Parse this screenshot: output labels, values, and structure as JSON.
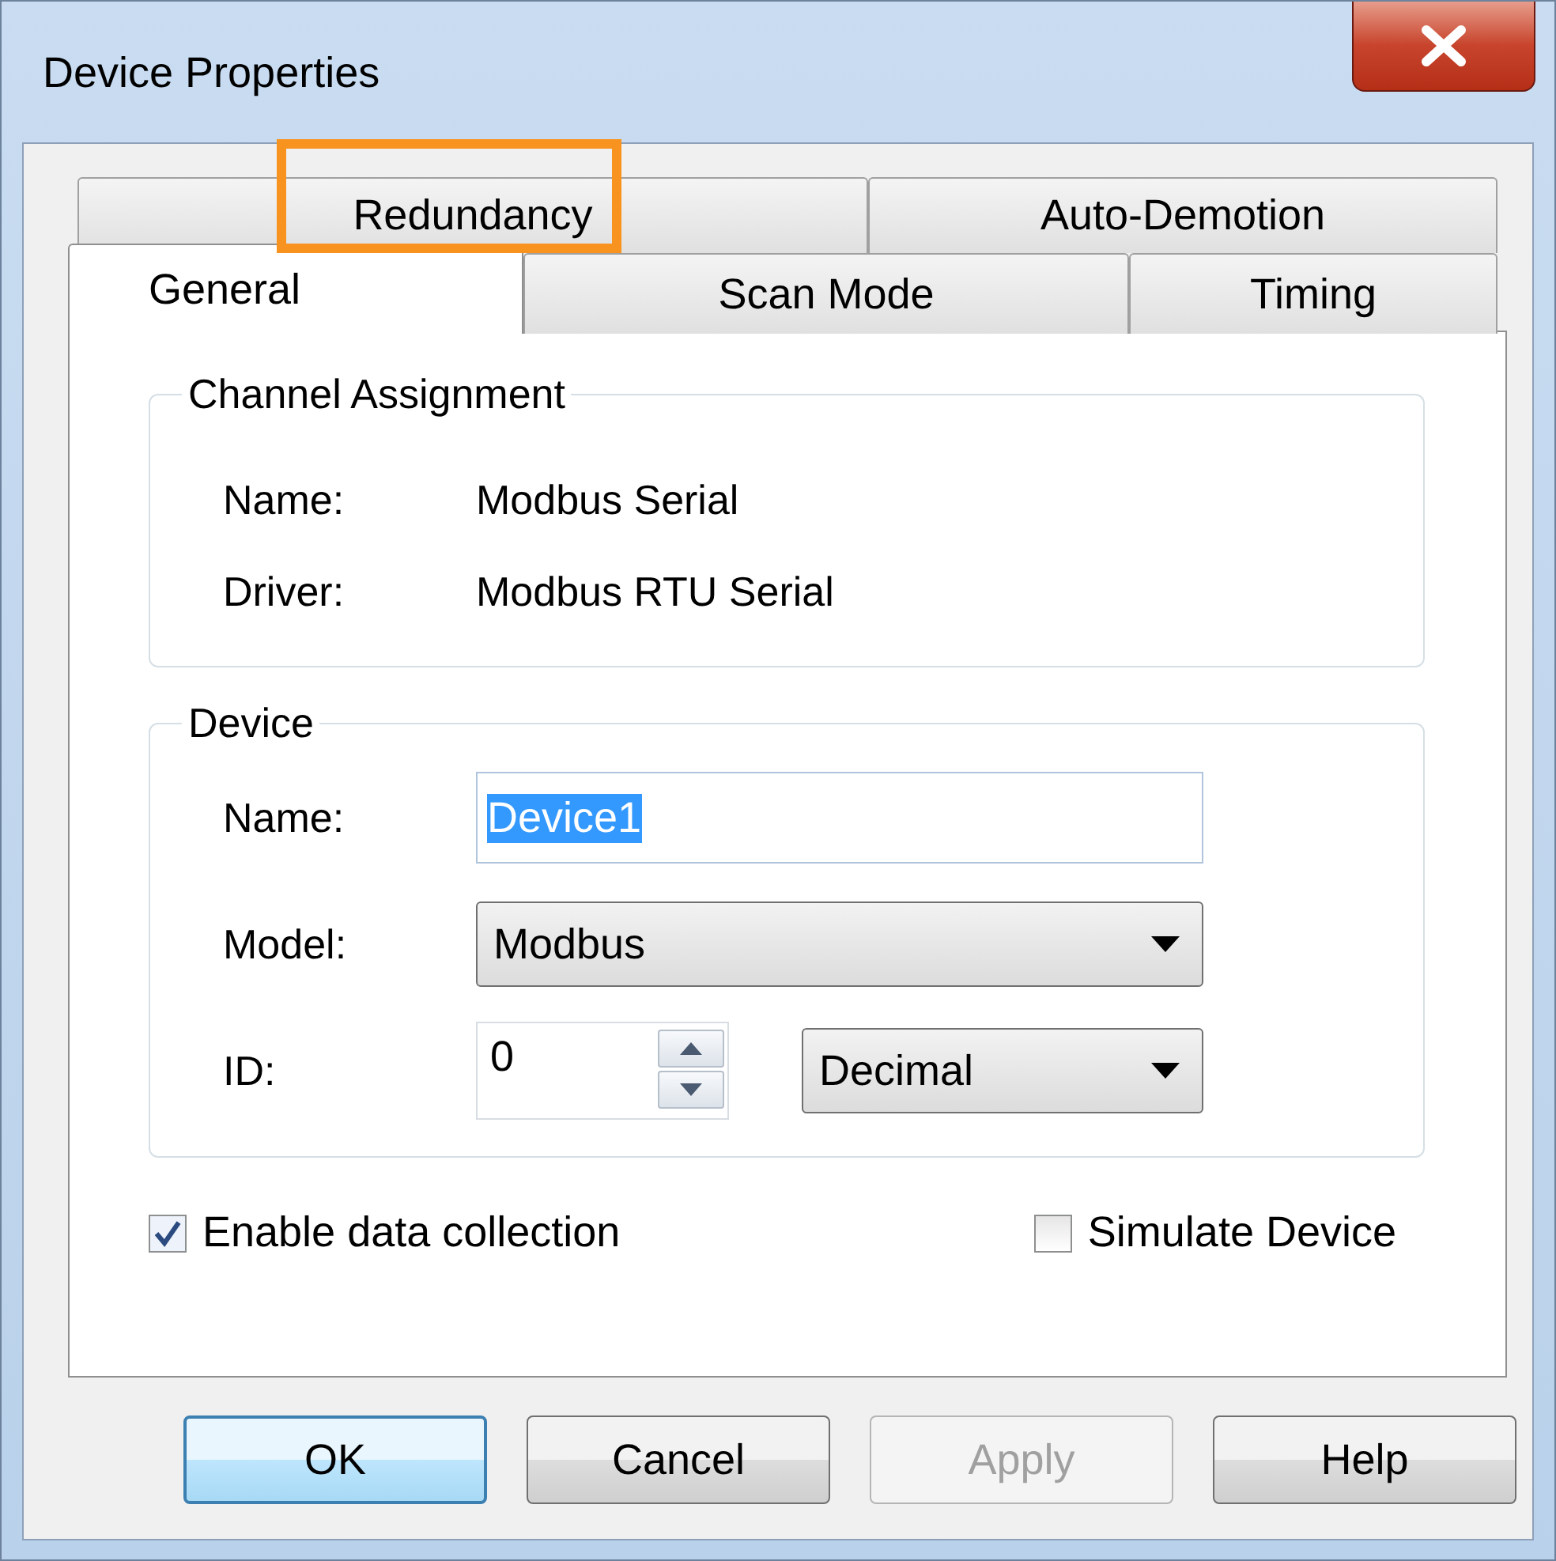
{
  "window": {
    "title": "Device Properties"
  },
  "tabs": {
    "back_row": [
      {
        "label": "Redundancy",
        "selected": false,
        "highlighted": true
      },
      {
        "label": "Auto-Demotion",
        "selected": false,
        "highlighted": false
      }
    ],
    "front_row": [
      {
        "label": "General",
        "selected": true,
        "highlighted": false
      },
      {
        "label": "Scan Mode",
        "selected": false,
        "highlighted": false
      },
      {
        "label": "Timing",
        "selected": false,
        "highlighted": false
      }
    ]
  },
  "channel_assignment": {
    "title": "Channel Assignment",
    "rows": [
      {
        "label": "Name:",
        "value": "Modbus Serial"
      },
      {
        "label": "Driver:",
        "value": "Modbus RTU Serial"
      }
    ]
  },
  "device": {
    "title": "Device",
    "name": {
      "label": "Name:",
      "value": "Device1",
      "text_selected": true
    },
    "model": {
      "label": "Model:",
      "value": "Modbus"
    },
    "id": {
      "label": "ID:",
      "value": "0",
      "format": "Decimal"
    }
  },
  "checkboxes": [
    {
      "label": "Enable data collection",
      "checked": true
    },
    {
      "label": "Simulate Device",
      "checked": false
    }
  ],
  "buttons": [
    {
      "label": "OK",
      "default": true,
      "disabled": false
    },
    {
      "label": "Cancel",
      "default": false,
      "disabled": false
    },
    {
      "label": "Apply",
      "default": false,
      "disabled": true
    },
    {
      "label": "Help",
      "default": false,
      "disabled": false
    }
  ]
}
